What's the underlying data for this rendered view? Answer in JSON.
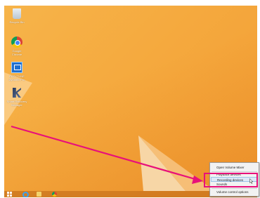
{
  "desktop": {
    "icons": [
      {
        "label_line1": "Recycle Bin",
        "label_line2": "",
        "icon": "recycle-bin-icon"
      },
      {
        "label_line1": "Google",
        "label_line2": "Chrome",
        "icon": "chrome-icon"
      },
      {
        "label_line1": "EASYTUNE",
        "label_line2": "Dynamic Pro",
        "icon": "easytune-icon"
      },
      {
        "label_line1": "Smart Recovery",
        "label_line2": "Manager",
        "icon": "smart-recovery-icon"
      }
    ]
  },
  "taskbar": {
    "items": [
      {
        "icon": "windows-start-icon"
      },
      {
        "icon": "internet-explorer-icon"
      },
      {
        "icon": "file-explorer-icon"
      },
      {
        "icon": "chrome-icon"
      }
    ]
  },
  "context_menu": {
    "items": [
      {
        "label": "Open Volume Mixer"
      },
      {
        "label": "Playback devices"
      },
      {
        "label": "Recording devices"
      },
      {
        "label": "Sounds"
      },
      {
        "label": "Volume control options"
      }
    ]
  },
  "annotation": {
    "color": "#e8107a"
  }
}
